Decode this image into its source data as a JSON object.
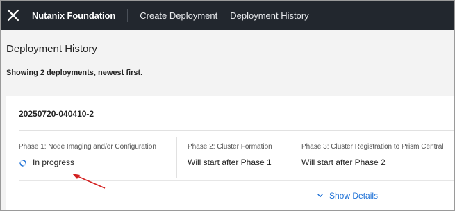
{
  "header": {
    "logo_icon": "nutanix-x-logo",
    "brand": "Nutanix Foundation",
    "nav": [
      "Create Deployment",
      "Deployment History"
    ]
  },
  "page": {
    "title": "Deployment History",
    "summary": "Showing 2 deployments, newest first."
  },
  "deployment": {
    "id": "20250720-040410-2",
    "phases": [
      {
        "label": "Phase 1: Node Imaging and/or Configuration",
        "status": "In progress",
        "icon": "spinner-icon"
      },
      {
        "label": "Phase 2: Cluster Formation",
        "status": "Will start after Phase 1"
      },
      {
        "label": "Phase 3: Cluster Registration to Prism Central",
        "status": "Will start after Phase 2"
      }
    ],
    "show_details": "Show Details"
  },
  "colors": {
    "topbar": "#22272e",
    "link": "#1b6fd6",
    "annotation_arrow": "#d32020"
  }
}
